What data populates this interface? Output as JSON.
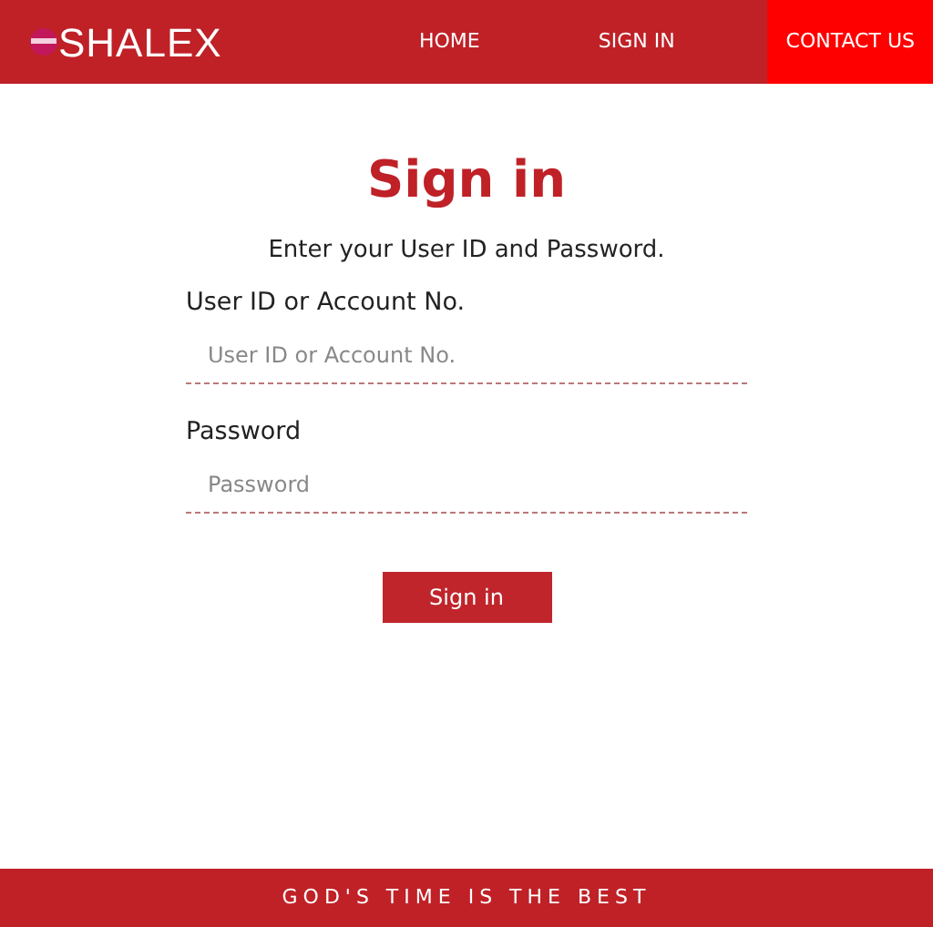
{
  "brand": {
    "name": "SHALEX"
  },
  "nav": [
    {
      "label": "HOME",
      "selected": false
    },
    {
      "label": "SIGN IN",
      "selected": false
    },
    {
      "label": "CONTACT US",
      "selected": true
    }
  ],
  "form": {
    "title": "Sign in",
    "subtitle": "Enter your User ID and Password.",
    "fields": [
      {
        "label": "User ID or Account No.",
        "placeholder": "User ID or Account No."
      },
      {
        "label": "Password",
        "placeholder": "Password"
      }
    ],
    "submit": "Sign in"
  },
  "footer": {
    "text": "GOD'S TIME IS THE BEST"
  }
}
